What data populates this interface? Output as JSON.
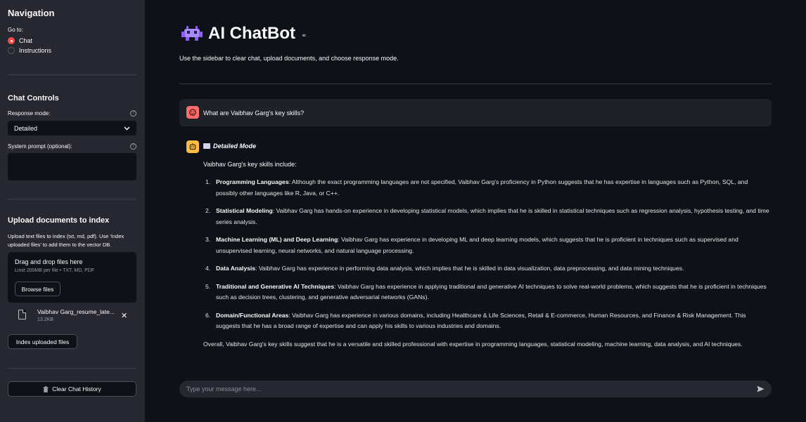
{
  "sidebar": {
    "nav_title": "Navigation",
    "goto_label": "Go to:",
    "radio_options": [
      {
        "label": "Chat",
        "selected": true
      },
      {
        "label": "Instructions",
        "selected": false
      }
    ],
    "chat_controls_title": "Chat Controls",
    "response_mode_label": "Response mode:",
    "response_mode_value": "Detailed",
    "system_prompt_label": "System prompt (optional):",
    "system_prompt_value": "",
    "upload_title": "Upload documents to index",
    "upload_desc": "Upload text files to index (txt, md, pdf). Use 'Index uploaded files' to add them to the vector DB.",
    "dropzone_title": "Drag and drop files here",
    "dropzone_limit": "Limit 200MB per file • TXT, MD, PDF",
    "browse_label": "Browse files",
    "file_name": "Vaibhav Garg_resume_late...",
    "file_size": "13.2KB",
    "index_label": "Index uploaded files",
    "clear_label": "Clear Chat History"
  },
  "main": {
    "title": "AI ChatBot",
    "subtitle": "Use the sidebar to clear chat, upload documents, and choose response mode.",
    "user_message": "What are Vaibhav Garg's key skills?",
    "bot_mode": "Detailed Mode",
    "bot_intro": "Vaibhav Garg's key skills include:",
    "skills": [
      {
        "num": "1.",
        "title": "Programming Languages",
        "text": ": Although the exact programming languages are not specified, Vaibhav Garg's proficiency in Python suggests that he has expertise in languages such as Python, SQL, and possibly other languages like R, Java, or C++."
      },
      {
        "num": "2.",
        "title": "Statistical Modeling",
        "text": ": Vaibhav Garg has hands-on experience in developing statistical models, which implies that he is skilled in statistical techniques such as regression analysis, hypothesis testing, and time series analysis."
      },
      {
        "num": "3.",
        "title": "Machine Learning (ML) and Deep Learning",
        "text": ": Vaibhav Garg has experience in developing ML and deep learning models, which suggests that he is proficient in techniques such as supervised and unsupervised learning, neural networks, and natural language processing."
      },
      {
        "num": "4.",
        "title": "Data Analysis",
        "text": ": Vaibhav Garg has experience in performing data analysis, which implies that he is skilled in data visualization, data preprocessing, and data mining techniques."
      },
      {
        "num": "5.",
        "title": "Traditional and Generative AI Techniques",
        "text": ": Vaibhav Garg has experience in applying traditional and generative AI techniques to solve real-world problems, which suggests that he is proficient in techniques such as decision trees, clustering, and generative adversarial networks (GANs)."
      },
      {
        "num": "6.",
        "title": "Domain/Functional Areas",
        "text": ": Vaibhav Garg has experience in various domains, including Healthcare & Life Sciences, Retail & E-commerce, Human Resources, and Finance & Risk Management. This suggests that he has a broad range of expertise and can apply his skills to various industries and domains."
      }
    ],
    "bot_outro": "Overall, Vaibhav Garg's key skills suggest that he is a versatile and skilled professional with expertise in programming languages, statistical modeling, machine learning, data analysis, and AI techniques.",
    "input_placeholder": "Type your message here..."
  },
  "colors": {
    "accent": "#ff4b4b",
    "sidebar_bg": "#262730",
    "main_bg": "#0e1117",
    "user_avatar": "#ff6b6b",
    "bot_avatar": "#ffbd45"
  },
  "icons": [
    "alien-icon",
    "link-icon",
    "help-icon",
    "chevron-down-icon",
    "file-icon",
    "close-icon",
    "trash-icon",
    "user-avatar-icon",
    "bot-avatar-icon",
    "book-icon",
    "send-icon"
  ]
}
